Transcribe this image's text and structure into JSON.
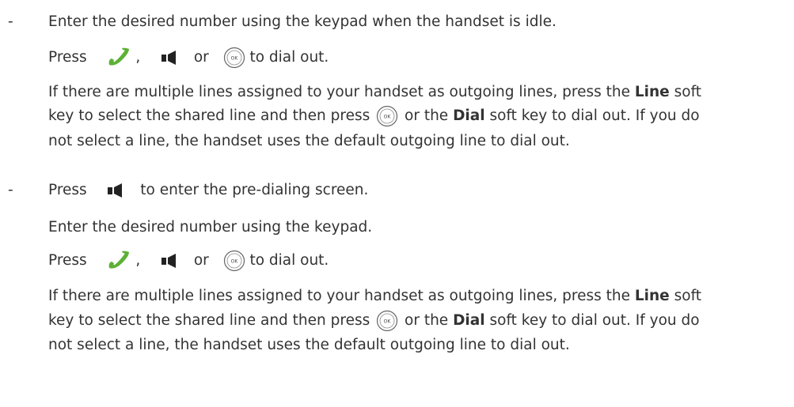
{
  "method1": {
    "bullet": "-",
    "step1": "Enter the desired number using the keypad when the handset is idle.",
    "press": "Press",
    "comma": ",",
    "or": "or",
    "to_dial": "to dial out.",
    "note1_a": "If there are multiple lines assigned to your handset as outgoing lines, press the",
    "note1_line": "Line",
    "note1_b": "soft",
    "note2_a": "key to select the shared line and then press",
    "note2_or": "or the",
    "note2_dial": "Dial",
    "note2_b": "soft key to dial out. If you do",
    "note3": "not select a line, the handset uses the default outgoing line to dial out."
  },
  "method2": {
    "bullet": "-",
    "press": "Press",
    "step1_tail": "to enter the pre-dialing screen.",
    "step2": "Enter the desired number using the keypad.",
    "comma": ",",
    "or": "or",
    "to_dial": "to dial out.",
    "note1_a": "If there are multiple lines assigned to your handset as outgoing lines, press the",
    "note1_line": "Line",
    "note1_b": "soft",
    "note2_a": "key to select the shared line and then press",
    "note2_or": "or the",
    "note2_dial": "Dial",
    "note2_b": "soft key to dial out. If you do",
    "note3": "not select a line, the handset uses the default outgoing line to dial out."
  },
  "icons": {
    "handset": "green-handset-icon",
    "speaker": "speakerphone-icon",
    "ok": "ok-key-icon",
    "ok_label": "OK",
    "handset_color": "#5cb135"
  }
}
